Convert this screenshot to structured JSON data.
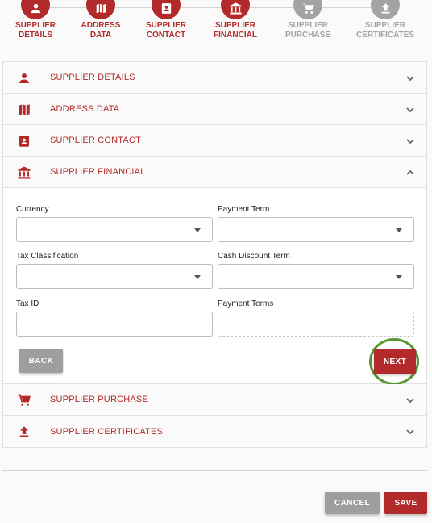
{
  "stepper": {
    "steps": [
      {
        "line1": "SUPPLIER",
        "line2": "DETAILS",
        "icon": "person-icon",
        "state": "done"
      },
      {
        "line1": "ADDRESS",
        "line2": "DATA",
        "icon": "map-icon",
        "state": "done"
      },
      {
        "line1": "SUPPLIER",
        "line2": "CONTACT",
        "icon": "contact-card-icon",
        "state": "done"
      },
      {
        "line1": "SUPPLIER",
        "line2": "FINANCIAL",
        "icon": "bank-icon",
        "state": "done"
      },
      {
        "line1": "SUPPLIER",
        "line2": "PURCHASE",
        "icon": "cart-icon",
        "state": "todo"
      },
      {
        "line1": "SUPPLIER",
        "line2": "CERTIFICATES",
        "icon": "upload-icon",
        "state": "todo"
      }
    ]
  },
  "accordion": {
    "sections": [
      {
        "title": "SUPPLIER DETAILS",
        "icon": "person-icon",
        "expanded": false
      },
      {
        "title": "ADDRESS DATA",
        "icon": "map-icon",
        "expanded": false
      },
      {
        "title": "SUPPLIER CONTACT",
        "icon": "contact-card-icon",
        "expanded": false
      },
      {
        "title": "SUPPLIER FINANCIAL",
        "icon": "bank-icon",
        "expanded": true
      },
      {
        "title": "SUPPLIER PURCHASE",
        "icon": "cart-icon",
        "expanded": false
      },
      {
        "title": "SUPPLIER CERTIFICATES",
        "icon": "upload-icon",
        "expanded": false
      }
    ]
  },
  "financial_form": {
    "currency": {
      "label": "Currency",
      "value": ""
    },
    "payment_term": {
      "label": "Payment Term",
      "value": ""
    },
    "tax_classification": {
      "label": "Tax Classification",
      "value": ""
    },
    "cash_discount_term": {
      "label": "Cash Discount Term",
      "value": ""
    },
    "tax_id": {
      "label": "Tax ID",
      "value": ""
    },
    "payment_terms": {
      "label": "Payment Terms",
      "value": ""
    },
    "back_label": "BACK",
    "next_label": "NEXT"
  },
  "footer": {
    "cancel_label": "CANCEL",
    "save_label": "SAVE"
  },
  "colors": {
    "accent": "#b32a2a",
    "inactive": "#a3a3a3",
    "highlight": "#559633"
  }
}
